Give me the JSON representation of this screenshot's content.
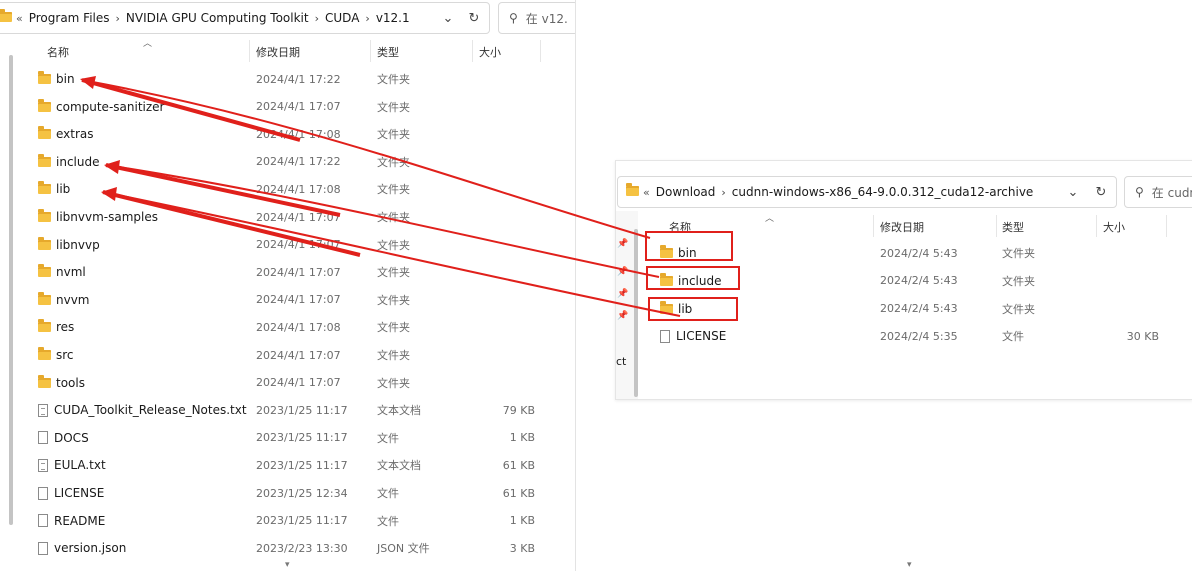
{
  "left": {
    "address": [
      "Program Files",
      "NVIDIA GPU Computing Toolkit",
      "CUDA",
      "v12.1"
    ],
    "lead_chevrons": "«",
    "search_placeholder": "在 v12.",
    "columns": {
      "name": "名称",
      "date": "修改日期",
      "type": "类型",
      "size": "大小"
    },
    "rows": [
      {
        "name": "bin",
        "date": "2024/4/1 17:22",
        "type": "文件夹",
        "size": "",
        "icon": "folder-icon"
      },
      {
        "name": "compute-sanitizer",
        "date": "2024/4/1 17:07",
        "type": "文件夹",
        "size": "",
        "icon": "folder-icon"
      },
      {
        "name": "extras",
        "date": "2024/4/1 17:08",
        "type": "文件夹",
        "size": "",
        "icon": "folder-icon"
      },
      {
        "name": "include",
        "date": "2024/4/1 17:22",
        "type": "文件夹",
        "size": "",
        "icon": "folder-icon"
      },
      {
        "name": "lib",
        "date": "2024/4/1 17:08",
        "type": "文件夹",
        "size": "",
        "icon": "folder-icon"
      },
      {
        "name": "libnvvm-samples",
        "date": "2024/4/1 17:07",
        "type": "文件夹",
        "size": "",
        "icon": "folder-icon"
      },
      {
        "name": "libnvvp",
        "date": "2024/4/1 17:07",
        "type": "文件夹",
        "size": "",
        "icon": "folder-icon"
      },
      {
        "name": "nvml",
        "date": "2024/4/1 17:07",
        "type": "文件夹",
        "size": "",
        "icon": "folder-icon"
      },
      {
        "name": "nvvm",
        "date": "2024/4/1 17:07",
        "type": "文件夹",
        "size": "",
        "icon": "folder-icon"
      },
      {
        "name": "res",
        "date": "2024/4/1 17:08",
        "type": "文件夹",
        "size": "",
        "icon": "folder-icon"
      },
      {
        "name": "src",
        "date": "2024/4/1 17:07",
        "type": "文件夹",
        "size": "",
        "icon": "folder-icon"
      },
      {
        "name": "tools",
        "date": "2024/4/1 17:07",
        "type": "文件夹",
        "size": "",
        "icon": "folder-icon"
      },
      {
        "name": "CUDA_Toolkit_Release_Notes.txt",
        "date": "2023/1/25 11:17",
        "type": "文本文档",
        "size": "79 KB",
        "icon": "text-file-icon"
      },
      {
        "name": "DOCS",
        "date": "2023/1/25 11:17",
        "type": "文件",
        "size": "1 KB",
        "icon": "file-icon"
      },
      {
        "name": "EULA.txt",
        "date": "2023/1/25 11:17",
        "type": "文本文档",
        "size": "61 KB",
        "icon": "text-file-icon"
      },
      {
        "name": "LICENSE",
        "date": "2023/1/25 12:34",
        "type": "文件",
        "size": "61 KB",
        "icon": "file-icon"
      },
      {
        "name": "README",
        "date": "2023/1/25 11:17",
        "type": "文件",
        "size": "1 KB",
        "icon": "file-icon"
      },
      {
        "name": "version.json",
        "date": "2023/2/23 13:30",
        "type": "JSON 文件",
        "size": "3 KB",
        "icon": "file-icon"
      }
    ]
  },
  "right": {
    "address": [
      "Download",
      "cudnn-windows-x86_64-9.0.0.312_cuda12-archive"
    ],
    "lead_chevrons": "«",
    "search_placeholder": "在 cudn",
    "nav_fragment": "ct",
    "columns": {
      "name": "名称",
      "date": "修改日期",
      "type": "类型",
      "size": "大小"
    },
    "rows": [
      {
        "name": "bin",
        "date": "2024/2/4 5:43",
        "type": "文件夹",
        "size": "",
        "icon": "folder-icon"
      },
      {
        "name": "include",
        "date": "2024/2/4 5:43",
        "type": "文件夹",
        "size": "",
        "icon": "folder-icon"
      },
      {
        "name": "lib",
        "date": "2024/2/4 5:43",
        "type": "文件夹",
        "size": "",
        "icon": "folder-icon"
      },
      {
        "name": "LICENSE",
        "date": "2024/2/4 5:35",
        "type": "文件",
        "size": "30 KB",
        "icon": "file-icon"
      }
    ]
  },
  "annotation": {
    "highlight_color": "#e0201b",
    "arrows": [
      {
        "from": "right.bin",
        "to": "left.bin"
      },
      {
        "from": "right.include",
        "to": "left.include"
      },
      {
        "from": "right.lib",
        "to": "left.lib"
      }
    ]
  }
}
